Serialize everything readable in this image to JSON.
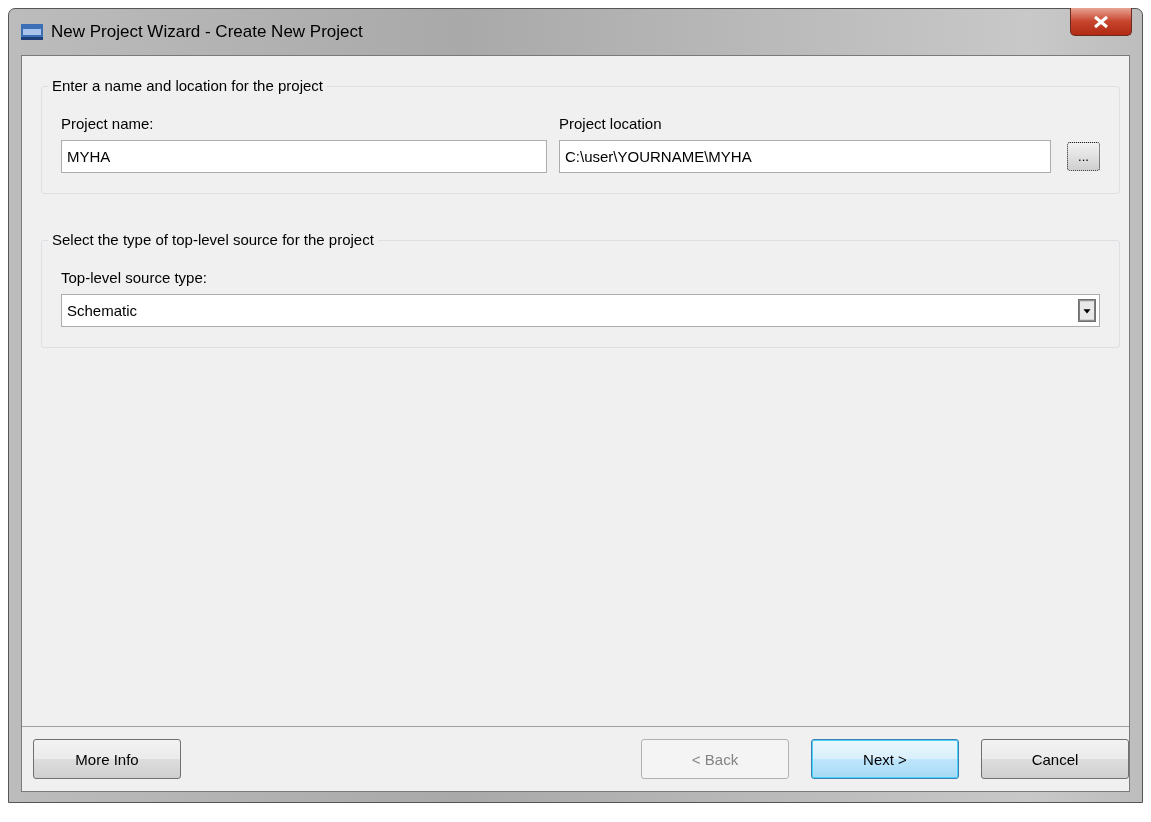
{
  "window": {
    "title": "New Project Wizard - Create New Project"
  },
  "name_location": {
    "legend": "Enter a name and location for the project",
    "project_name": {
      "label": "Project name:",
      "value": "MYHA"
    },
    "project_location": {
      "label": "Project location",
      "value": "C:\\user\\YOURNAME\\MYHA"
    },
    "browse_button": "..."
  },
  "source_type": {
    "legend": "Select the type of top-level source for the project",
    "label": "Top-level source type:",
    "value": "Schematic"
  },
  "buttons": [
    {
      "label": "More Info",
      "disabled": false,
      "default": false
    },
    {
      "label": "< Back",
      "disabled": true,
      "default": false
    },
    {
      "label": "Next >",
      "disabled": false,
      "default": true
    },
    {
      "label": "Cancel",
      "disabled": false,
      "default": false
    }
  ]
}
